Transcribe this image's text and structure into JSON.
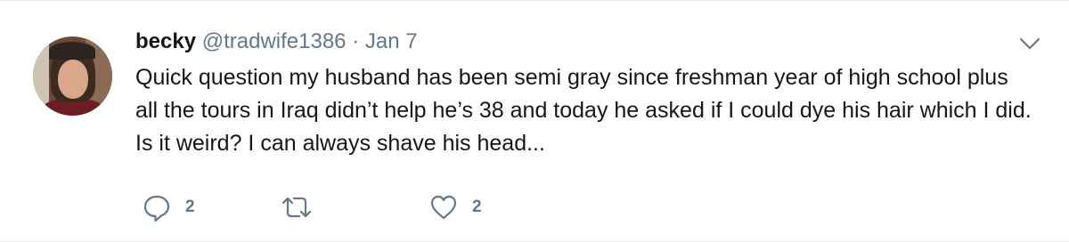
{
  "tweet": {
    "author_name": "becky",
    "author_handle": "@tradwife1386",
    "separator": "·",
    "date": "Jan 7",
    "text": "Quick question my husband has been semi gray since freshman year of high school plus all the tours in Iraq didn’t help he’s 38 and today he asked if I could dye his hair which I did. Is it weird? I can always shave his head...",
    "actions": {
      "reply": {
        "icon": "reply-icon",
        "count": "2"
      },
      "retweet": {
        "icon": "retweet-icon",
        "count": ""
      },
      "like": {
        "icon": "heart-icon",
        "count": "2"
      }
    },
    "menu_icon": "chevron-down-icon"
  },
  "colors": {
    "text": "#14171a",
    "secondary": "#657786",
    "border": "#e6ecf0"
  }
}
